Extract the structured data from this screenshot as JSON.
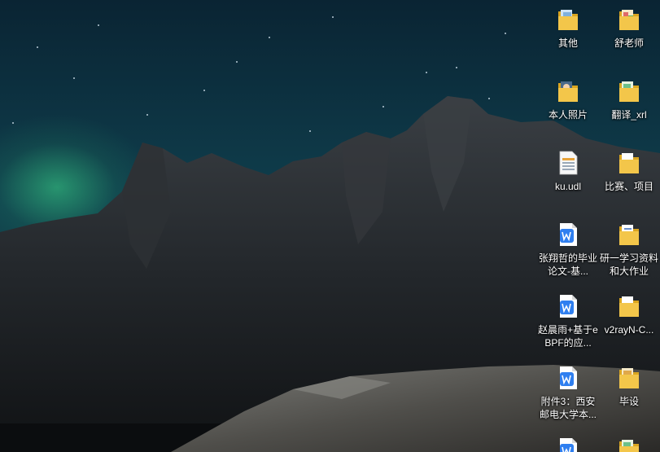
{
  "desktop": {
    "icons": [
      {
        "label": "其他",
        "type": "folder-icon",
        "variant": "photo"
      },
      {
        "label": "舒老师",
        "type": "folder-icon",
        "variant": "colorful"
      },
      {
        "label": "本人照片",
        "type": "folder-icon",
        "variant": "photo"
      },
      {
        "label": "翻译_xrl",
        "type": "folder-icon",
        "variant": "colorful"
      },
      {
        "label": "ku.udl",
        "type": "udl-file-icon",
        "variant": "file"
      },
      {
        "label": "比赛、项目",
        "type": "folder-icon",
        "variant": "plain"
      },
      {
        "label": "张翔哲的毕业论文-基...",
        "type": "wps-doc-icon",
        "variant": "doc"
      },
      {
        "label": "研一学习资料和大作业",
        "type": "folder-icon",
        "variant": "doc"
      },
      {
        "label": "赵晨雨+基于eBPF的应...",
        "type": "wps-doc-icon",
        "variant": "doc"
      },
      {
        "label": "v2rayN-C...",
        "type": "folder-icon",
        "variant": "plain"
      },
      {
        "label": "附件3：西安邮电大学本...",
        "type": "wps-doc-icon",
        "variant": "doc"
      },
      {
        "label": "毕设",
        "type": "folder-icon",
        "variant": "colorful"
      },
      {
        "label": "",
        "type": "wps-doc-icon",
        "variant": "doc"
      },
      {
        "label": "",
        "type": "folder-icon",
        "variant": "colorful"
      }
    ],
    "colors": {
      "folder": "#f3c64a",
      "folder_dark": "#d9a520",
      "wps_blue": "#2f7ff0",
      "label_text": "#ffffff"
    }
  }
}
